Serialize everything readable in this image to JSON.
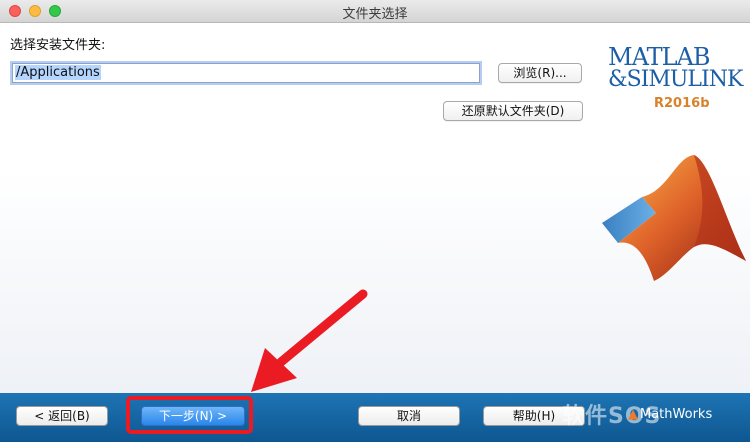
{
  "window": {
    "title": "文件夹选择"
  },
  "form": {
    "label": "选择安装文件夹:",
    "path_value": "/Applications",
    "browse_label": "浏览(R)...",
    "restore_label": "还原默认文件夹(D)"
  },
  "brand": {
    "line1": "MATLAB",
    "line2": "&SIMULINK",
    "release": "R2016b"
  },
  "footer": {
    "back_label": "< 返回(B)",
    "next_label": "下一步(N) >",
    "cancel_label": "取消",
    "help_label": "帮助(H)",
    "mathworks_label": "MathWorks",
    "watermark": "软件SOS"
  },
  "annotation": {
    "color": "#ea1b23"
  },
  "colors": {
    "footer_bg": "#1565a8",
    "primary_button": "#2a86eb",
    "brand_blue": "#1d5fa6",
    "brand_orange": "#d8822b"
  }
}
